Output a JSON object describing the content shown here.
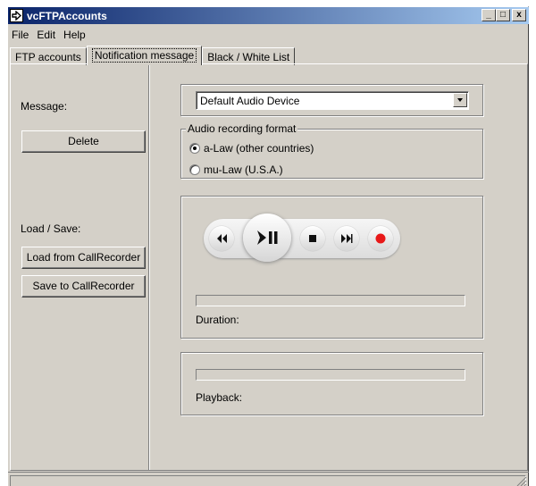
{
  "window": {
    "title": "vcFTPAccounts",
    "buttons": [
      "_",
      "□",
      "x"
    ]
  },
  "menu": [
    "File",
    "Edit",
    "Help"
  ],
  "tabs": [
    {
      "label": "FTP accounts",
      "active": false
    },
    {
      "label": "Notification message",
      "active": true
    },
    {
      "label": "Black / White List",
      "active": false
    }
  ],
  "left": {
    "message_label": "Message:",
    "delete_button": "Delete",
    "load_save_label": "Load / Save:",
    "load_button": "Load from CallRecorder",
    "save_button": "Save to CallRecorder"
  },
  "device": {
    "selected": "Default Audio Device"
  },
  "format": {
    "legend": "Audio recording format",
    "options": [
      {
        "label": "a-Law (other countries)",
        "checked": true
      },
      {
        "label": "mu-Law (U.S.A.)",
        "checked": false
      }
    ]
  },
  "player": {
    "icons": [
      "rewind-icon",
      "play-pause-icon",
      "stop-icon",
      "fast-forward-icon",
      "record-icon"
    ],
    "duration_label": "Duration:",
    "playback_label": "Playback:",
    "record_color": "#e81818"
  }
}
